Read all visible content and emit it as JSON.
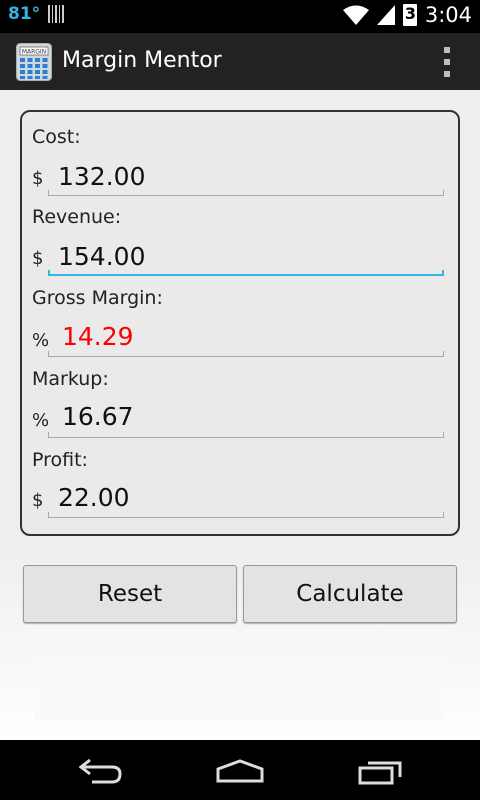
{
  "status_bar": {
    "temperature": "81°",
    "battery_level": "3",
    "time": "3:04"
  },
  "action_bar": {
    "title": "Margin Mentor",
    "icon_label": "MARGIN"
  },
  "form": {
    "cost": {
      "label": "Cost:",
      "prefix": "$",
      "value": "132.00"
    },
    "revenue": {
      "label": "Revenue:",
      "prefix": "$",
      "value": "154.00"
    },
    "gross_margin": {
      "label": "Gross Margin:",
      "prefix": "%",
      "value": "14.29",
      "value_color": "#ff0000"
    },
    "markup": {
      "label": "Markup:",
      "prefix": "%",
      "value": "16.67"
    },
    "profit": {
      "label": "Profit:",
      "prefix": "$",
      "value": "22.00"
    }
  },
  "buttons": {
    "reset": "Reset",
    "calculate": "Calculate"
  },
  "colors": {
    "accent": "#33b5e5",
    "action_bar": "#222222"
  }
}
